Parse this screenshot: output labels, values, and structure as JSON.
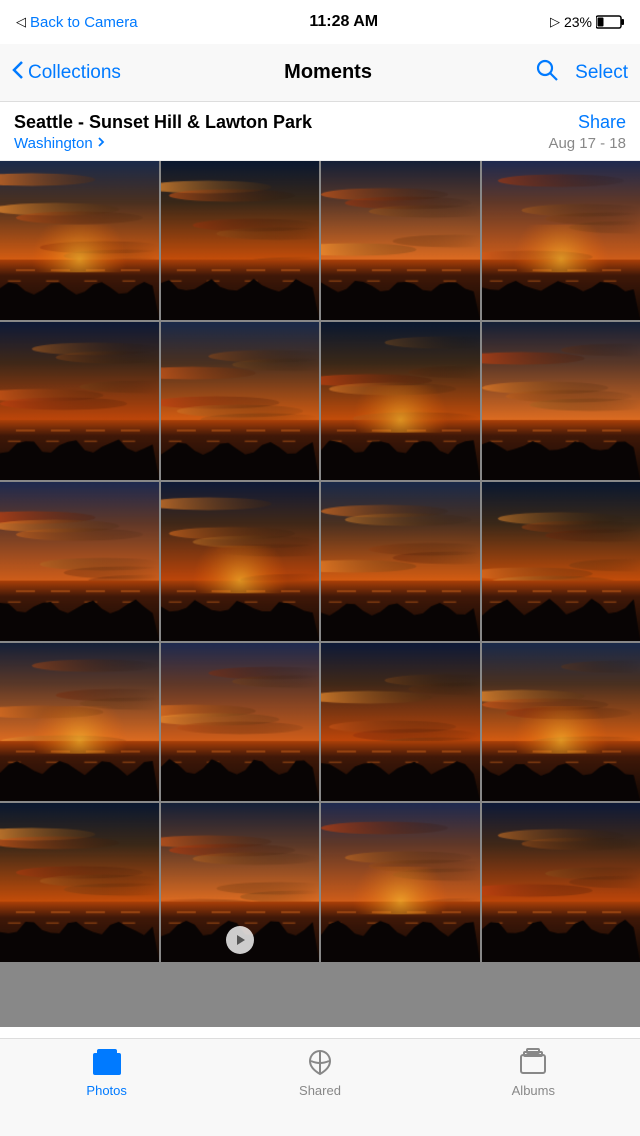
{
  "status_bar": {
    "back_text": "Back to Camera",
    "time": "11:28 AM",
    "location_icon": "▷",
    "battery": "23%"
  },
  "nav": {
    "collections_label": "Collections",
    "title": "Moments",
    "select_label": "Select"
  },
  "moment": {
    "title": "Seattle - Sunset Hill & Lawton Park",
    "share_label": "Share",
    "location": "Washington",
    "date_range": "Aug 17 - 18"
  },
  "photos": {
    "count": 20
  },
  "tab_bar": {
    "photos_label": "Photos",
    "shared_label": "Shared",
    "albums_label": "Albums"
  },
  "colors": {
    "accent": "#007aff",
    "inactive_tab": "#888888"
  }
}
